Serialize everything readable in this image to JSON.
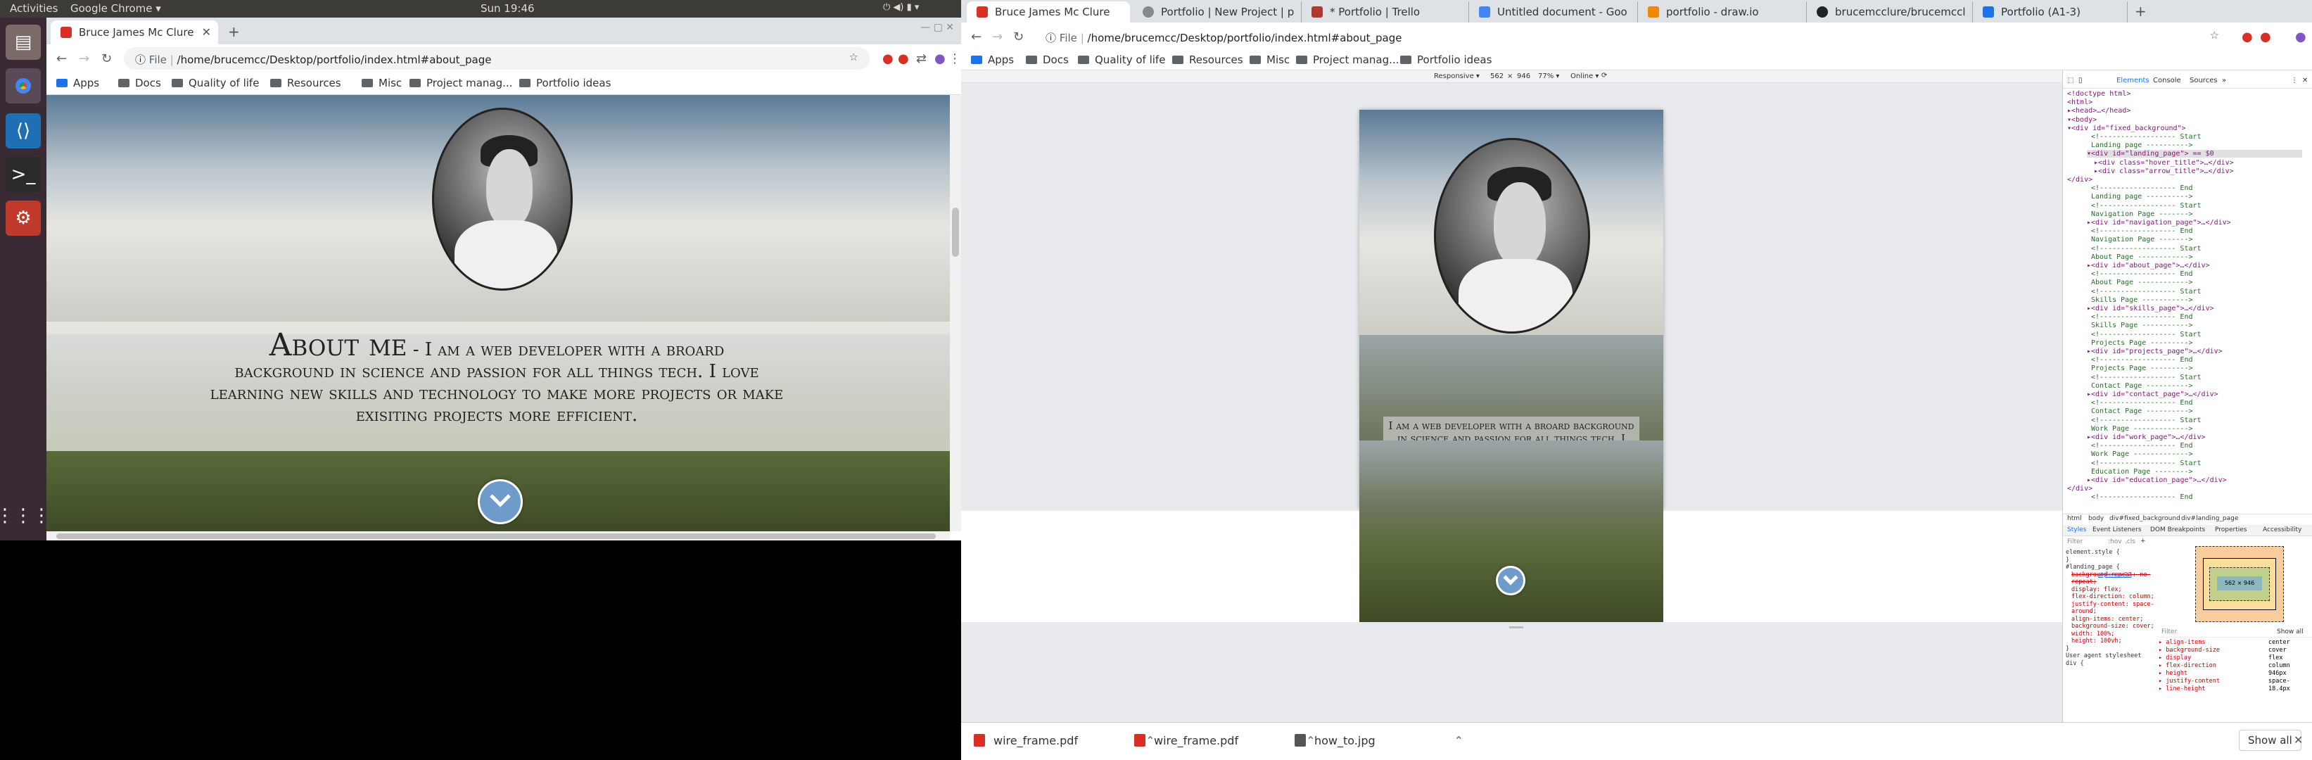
{
  "topbar": {
    "activities": "Activities",
    "app": "Google Chrome ▾",
    "clock": "Sun 19:46"
  },
  "left_browser": {
    "tab_title": "Bruce James Mc Clure",
    "url_scheme": "File",
    "url": "/home/brucemcc/Desktop/portfolio/index.html#about_page",
    "bookmarks": [
      "Apps",
      "Docs",
      "Quality of life",
      "Resources",
      "Misc",
      "Project manag...",
      "Portfolio ideas"
    ]
  },
  "about": {
    "heading": "About me",
    "body_first": " - I am a web developer with a broard",
    "body_rest": "background in science and passion for all things tech. I love learning new skills and technology to make more projects or make exisiting projects more efficient."
  },
  "right_browser": {
    "tabs": [
      "Bruce James Mc Clure",
      "Portfolio | New Project | p",
      "* Portfolio | Trello",
      "Untitled document - Goo",
      "portfolio - draw.io",
      "brucemcclure/brucemccl",
      "Portfolio (A1-3)"
    ],
    "url_scheme": "File",
    "url": "/home/brucemcc/Desktop/portfolio/index.html#about_page",
    "bookmarks": [
      "Apps",
      "Docs",
      "Quality of life",
      "Resources",
      "Misc",
      "Project manag...",
      "Portfolio ideas"
    ]
  },
  "device_toolbar": {
    "mode": "Responsive ▾",
    "width": "562",
    "x": "×",
    "height": "946",
    "zoom": "77% ▾",
    "network": "Online ▾"
  },
  "mobile_about": {
    "text": "I am a web developer with a broard background in science and passion for all things tech. I love learning new skills and technology to make more projects or make exisiting projects more efficient."
  },
  "devtools": {
    "tabs": [
      "Elements",
      "Console",
      "Sources",
      "»"
    ],
    "dom_lines": [
      "<!doctype html>",
      "<html>",
      "▸<head>…</head>",
      "▾<body>",
      "▾<div id=\"fixed_background\">",
      "<!------------------ Start",
      "Landing page ---------->",
      "▾<div id=\"landing_page\"> == $0",
      "▸<div class=\"hover_title\">…</div>",
      "▸<div class=\"arrow_title\">…</div>",
      "</div>",
      "<!------------------ End",
      "Landing page ---------->",
      "<!------------------ Start",
      "Navigation Page ------->",
      "▸<div id=\"navigation_page\">…</div>",
      "<!------------------ End",
      "Navigation Page ------->",
      "<!------------------ Start",
      "About Page ------------>",
      "▸<div id=\"about_page\">…</div>",
      "<!------------------ End",
      "About Page ------------>",
      "<!------------------ Start",
      "Skills Page ----------->",
      "▸<div id=\"skills_page\">…</div>",
      "<!------------------ End",
      "Skills Page ----------->",
      "<!------------------ Start",
      "Projects Page --------->",
      "▸<div id=\"projects_page\">…</div>",
      "<!------------------ End",
      "Projects Page --------->",
      "<!------------------ Start",
      "Contact Page ---------->",
      "▸<div id=\"contact_page\">…</div>",
      "<!------------------ End",
      "Contact Page ---------->",
      "<!------------------ Start",
      "Work Page ------------->",
      "▸<div id=\"work_page\">…</div>",
      "<!------------------ End",
      "Work Page ------------->",
      "<!------------------ Start",
      "Education Page -------->",
      "▸<div id=\"education_page\">…</div>",
      "</div>",
      "<!------------------ End"
    ],
    "breadcrumbs": [
      "html",
      "body",
      "div#fixed_background",
      "div#landing_page"
    ],
    "style_tabs": [
      "Styles",
      "Event Listeners",
      "DOM Breakpoints",
      "Properties",
      "Accessibility"
    ],
    "filter": "Filter",
    "hov": ":hov",
    "cls": ".cls",
    "style_rules": [
      "element.style {",
      "}",
      "#landing_page {",
      "background-repeat: no-repeat;",
      "display: flex;",
      "flex-direction: column;",
      "justify-content: space-around;",
      "align-items: center;",
      "background-size: cover;",
      "width: 100%;",
      "height: 100vh;",
      "}",
      "User agent stylesheet",
      "div {"
    ],
    "style_source": "style.css:12",
    "box_size": "562 × 946",
    "computed_filter": "Filter",
    "show_all": "Show all",
    "computed": [
      [
        "align-items",
        "center"
      ],
      [
        "background-size",
        "cover"
      ],
      [
        "display",
        "flex"
      ],
      [
        "flex-direction",
        "column"
      ],
      [
        "height",
        "946px"
      ],
      [
        "justify-content",
        "space-"
      ],
      [
        "line-height",
        "18.4px"
      ]
    ]
  },
  "downloads": {
    "items": [
      "wire_frame.pdf",
      "wire_frame.pdf",
      "how_to.jpg"
    ],
    "show_all": "Show all"
  }
}
